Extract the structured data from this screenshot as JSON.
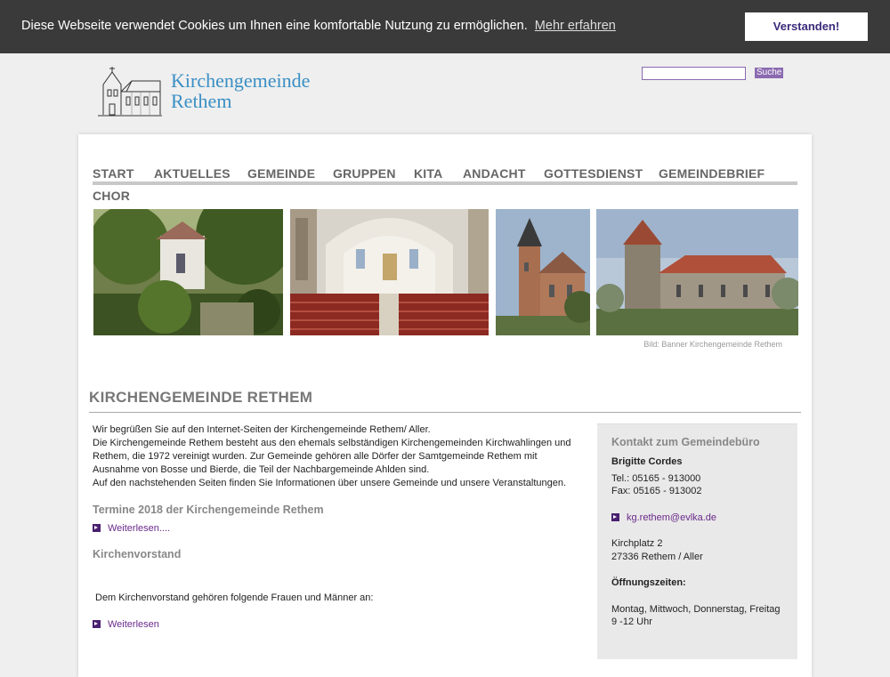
{
  "cookie": {
    "message": "Diese Webseite verwendet Cookies um Ihnen eine komfortable Nutzung zu ermöglichen.",
    "link": "Mehr erfahren",
    "button": "Verstanden!"
  },
  "header": {
    "logo_line1": "Kirchengemeinde",
    "logo_line2": "Rethem",
    "search_placeholder": "",
    "search_button": "Suche"
  },
  "nav": {
    "items": [
      "START",
      "AKTUELLES",
      "GEMEINDE",
      "GRUPPEN",
      "KITA",
      "ANDACHT",
      "GOTTESDIENST",
      "GEMEINDEBRIEF",
      "CHOR"
    ]
  },
  "banner": {
    "caption": "Bild: Banner Kirchengemeinde Rethem"
  },
  "main": {
    "title": "KIRCHENGEMEINDE RETHEM",
    "intro_lines": [
      "Wir begrüßen Sie auf den Internet-Seiten der Kirchengemeinde Rethem/ Aller.",
      "Die Kirchengemeinde Rethem besteht aus den ehemals selbständigen Kirchengemeinden Kirchwahlingen und Rethem, die 1972 vereinigt wurden. Zur Gemeinde gehören alle Dörfer der Samtgemeinde Rethem mit Ausnahme von Bosse und Bierde, die Teil der Nachbargemeinde Ahlden sind.",
      "Auf den nachstehenden Seiten finden Sie Informationen über unsere Gemeinde und unsere Veranstaltungen."
    ],
    "termine_heading": "Termine 2018 der Kirchengemeinde Rethem",
    "termine_link": "Weiterlesen....",
    "kv_heading": "Kirchenvorstand",
    "kv_text": "Dem Kirchenvorstand gehören folgende Frauen und Männer an:",
    "kv_link": "Weiterlesen"
  },
  "sidebar": {
    "title": "Kontakt zum Gemeindebüro",
    "name": "Brigitte Cordes",
    "tel": "Tel.: 05165 - 913000",
    "fax": "Fax: 05165 - 913002",
    "email": "kg.rethem@evlka.de",
    "street": "Kirchplatz 2",
    "city": "27336 Rethem / Aller",
    "hours_label": "Öffnungszeiten:",
    "hours_days": "Montag, Mittwoch, Donnerstag, Freitag",
    "hours_time": "9 -12 Uhr"
  },
  "colors": {
    "cookie_bg": "#3a3a3a",
    "accent_purple": "#6a2a8a",
    "logo_blue": "#3a8fc4",
    "nav_gray": "#666666"
  }
}
